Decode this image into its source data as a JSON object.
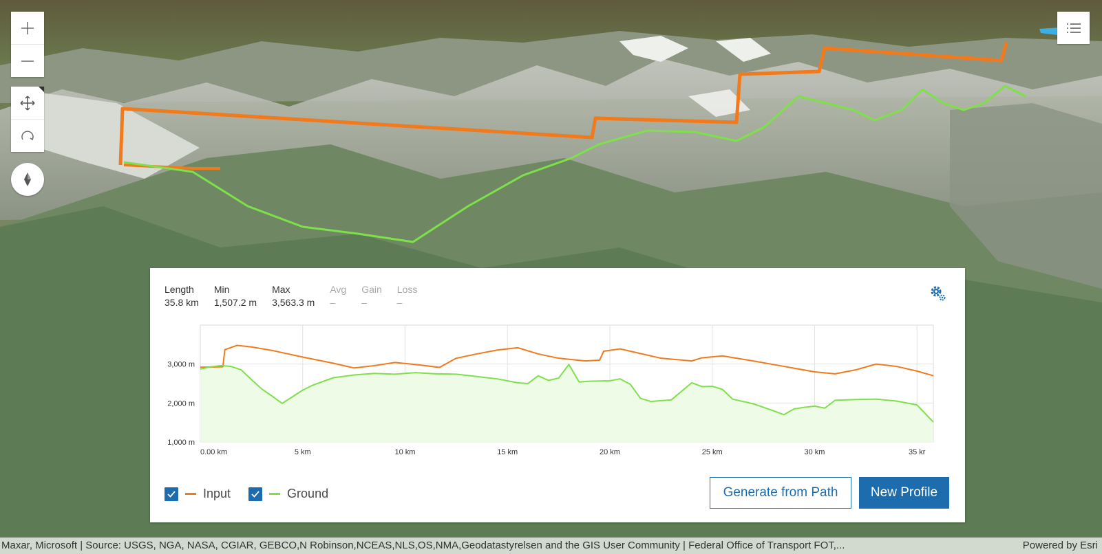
{
  "stats": {
    "length": {
      "label": "Length",
      "value": "35.8 km"
    },
    "min": {
      "label": "Min",
      "value": "1,507.2 m"
    },
    "max": {
      "label": "Max",
      "value": "3,563.3 m"
    },
    "avg": {
      "label": "Avg",
      "value": "–"
    },
    "gain": {
      "label": "Gain",
      "value": "–"
    },
    "loss": {
      "label": "Loss",
      "value": "–"
    }
  },
  "legend": {
    "input_label": "Input",
    "ground_label": "Ground"
  },
  "buttons": {
    "generate_label": "Generate from Path",
    "new_profile_label": "New Profile"
  },
  "attribution": {
    "source": "Maxar, Microsoft | Source: USGS, NGA, NASA, CGIAR, GEBCO,N Robinson,NCEAS,NLS,OS,NMA,Geodatastyrelsen and the GIS User Community | Federal Office of Transport FOT,...",
    "powered_by": "Powered by Esri"
  },
  "colors": {
    "input": "#f07a1c",
    "ground": "#7ee04a",
    "accent": "#1d6dae"
  },
  "chart_data": {
    "type": "area",
    "xlabel": "",
    "ylabel": "",
    "x_ticks": [
      "0.00 km",
      "5 km",
      "10 km",
      "15 km",
      "20 km",
      "25 km",
      "30 km",
      "35 kr"
    ],
    "y_ticks": [
      "1,000 m",
      "2,000 m",
      "3,000 m"
    ],
    "xlim": [
      0,
      35.8
    ],
    "ylim": [
      1000,
      4000
    ],
    "grid": true,
    "series": [
      {
        "name": "Input",
        "x": [
          0,
          1.1,
          1.2,
          1.8,
          2.5,
          3.5,
          5.0,
          6.5,
          7.5,
          8.5,
          9.5,
          10.5,
          11.6,
          11.7,
          12.5,
          13.5,
          14.5,
          15.5,
          16.5,
          17.5,
          18.8,
          19.5,
          19.7,
          20.5,
          21.5,
          22.5,
          24.0,
          24.5,
          25.5,
          27.0,
          28.5,
          30.0,
          31.0,
          32.0,
          33.0,
          34.0,
          35.0,
          35.8
        ],
        "values": [
          2920,
          2930,
          3370,
          3480,
          3440,
          3350,
          3180,
          3020,
          2900,
          2960,
          3040,
          2990,
          2920,
          2920,
          3150,
          3260,
          3360,
          3420,
          3260,
          3150,
          3080,
          3100,
          3330,
          3390,
          3270,
          3150,
          3080,
          3160,
          3210,
          3080,
          2940,
          2800,
          2750,
          2850,
          3000,
          2940,
          2820,
          2700
        ]
      },
      {
        "name": "Ground",
        "x": [
          0,
          0.5,
          1.0,
          1.5,
          2.0,
          2.5,
          3.0,
          3.5,
          4.0,
          4.5,
          5.0,
          5.5,
          6.5,
          7.5,
          8.5,
          9.5,
          10.5,
          11.5,
          12.5,
          13.5,
          14.5,
          15.5,
          16.0,
          16.5,
          17.0,
          17.5,
          18.0,
          18.5,
          19.0,
          20.0,
          20.5,
          21.0,
          21.5,
          22.0,
          23.0,
          23.5,
          24.0,
          24.5,
          25.0,
          25.5,
          26.0,
          27.0,
          28.0,
          28.5,
          29.0,
          29.5,
          30.0,
          30.5,
          31.0,
          32.0,
          33.0,
          34.0,
          35.0,
          35.8
        ],
        "values": [
          2870,
          2930,
          2960,
          2940,
          2850,
          2600,
          2360,
          2180,
          1990,
          2160,
          2330,
          2460,
          2650,
          2720,
          2760,
          2740,
          2780,
          2750,
          2740,
          2680,
          2620,
          2520,
          2500,
          2700,
          2580,
          2640,
          2990,
          2540,
          2560,
          2570,
          2620,
          2480,
          2120,
          2040,
          2080,
          2300,
          2520,
          2420,
          2430,
          2350,
          2100,
          1980,
          1800,
          1700,
          1850,
          1890,
          1920,
          1870,
          2070,
          2090,
          2100,
          2050,
          1950,
          1510
        ]
      }
    ]
  }
}
